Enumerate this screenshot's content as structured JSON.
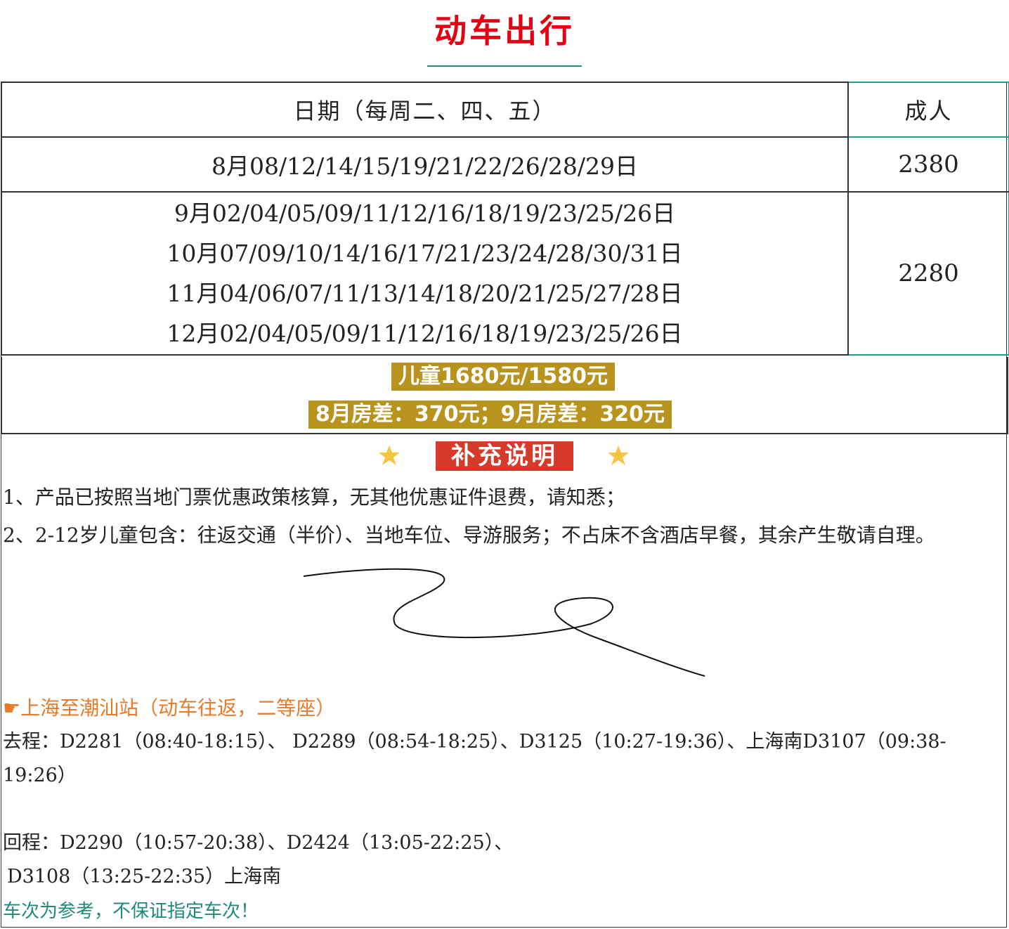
{
  "title": "动车出行",
  "table": {
    "header": {
      "date": "日期（每周二、四、五）",
      "adult": "成人"
    },
    "row1": {
      "date": "8月08/12/14/15/19/21/22/26/28/29日",
      "price": "2380"
    },
    "row2": {
      "dates": [
        "9月02/04/05/09/11/12/16/18/19/23/25/26日",
        "10月07/09/10/14/16/17/21/23/24/28/30/31日",
        "11月04/06/07/11/13/14/18/20/21/25/27/28日",
        "12月02/04/05/09/11/12/16/18/19/23/25/26日"
      ],
      "price": "2280"
    }
  },
  "extras": {
    "child": "儿童1680元/1580元",
    "room": "8月房差：370元；9月房差：320元"
  },
  "supplement": {
    "heading": "补充说明",
    "notes": [
      "1、产品已按照当地门票优惠政策核算，无其他优惠证件退费，请知悉；",
      "2、2-12岁儿童包含：往返交通（半价）、当地车位、导游服务；不占床不含酒店早餐，其余产生敬请自理。"
    ]
  },
  "trains": {
    "title": "☛上海至潮汕站（动车往返，二等座）",
    "outbound": "去程：D2281（08:40-18:15）、 D2289（08:54-18:25）、D3125（10:27-19:36）、上海南D3107（09:38-19:26）",
    "return_line1": "回程：D2290（10:57-20:38）、D2424（13:05-22:25）、",
    "return_line2": "D3108（13:25-22:35）上海南",
    "disclaimer": "车次为参考，不保证指定车次！"
  },
  "colors": {
    "title": "#e60012",
    "accent": "#2a9a8a",
    "gold": "#b8941f",
    "badge": "#d63a2a",
    "orange": "#e87a2a"
  }
}
